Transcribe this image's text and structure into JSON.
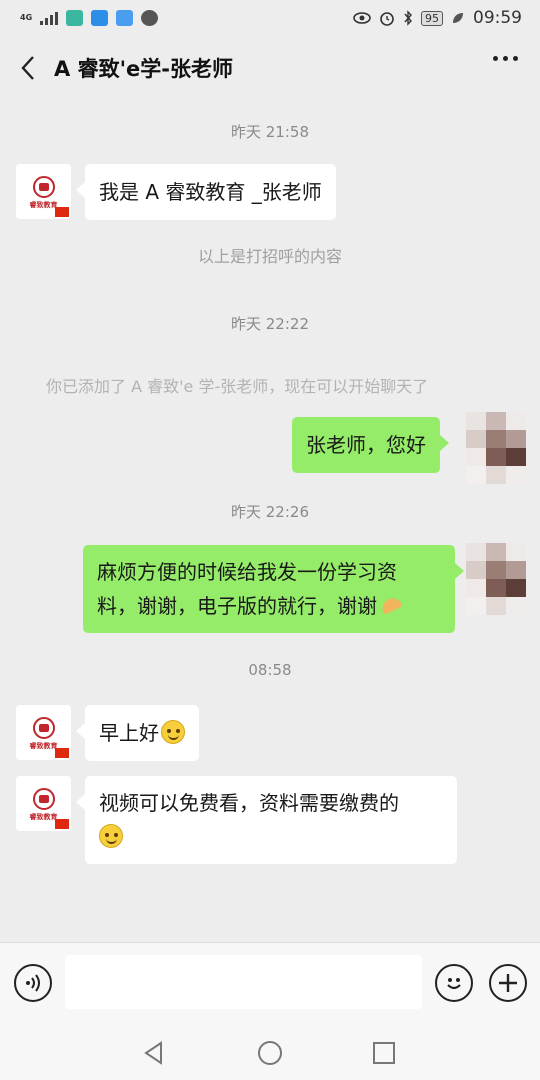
{
  "status_bar": {
    "network": "4G",
    "battery": "95",
    "time": "09:59",
    "left_icons": [
      "signal-icon",
      "alipay-icon",
      "game-icon",
      "delivery-icon",
      "message-icon"
    ],
    "right_icons": [
      "eye-icon",
      "alarm-icon",
      "bluetooth-icon",
      "battery-icon",
      "leaf-icon"
    ]
  },
  "header": {
    "title": "A  睿致'e学-张老师"
  },
  "chat": {
    "time_1": "昨天 21:58",
    "msg_1": "我是 A 睿致教育 _张老师",
    "greeting_note": "以上是打招呼的内容",
    "time_2": "昨天 22:22",
    "added_note": "你已添加了 A  睿致'e 学-张老师，现在可以开始聊天了",
    "msg_2": "张老师，您好",
    "time_3": "昨天 22:26",
    "msg_3_line1": "麻烦方便的时候给我发一份学习资",
    "msg_3_line2": "料，谢谢，电子版的就行，谢谢",
    "time_4": "08:58",
    "msg_4": "早上好",
    "msg_5": "视频可以免费看，资料需要缴费的"
  },
  "avatar": {
    "brand_text": "睿致教育"
  },
  "input_bar": {
    "placeholder": ""
  },
  "colors": {
    "background": "#ededed",
    "bubble_out": "#95ec69",
    "bubble_in": "#ffffff",
    "brand_red": "#c0272d"
  }
}
